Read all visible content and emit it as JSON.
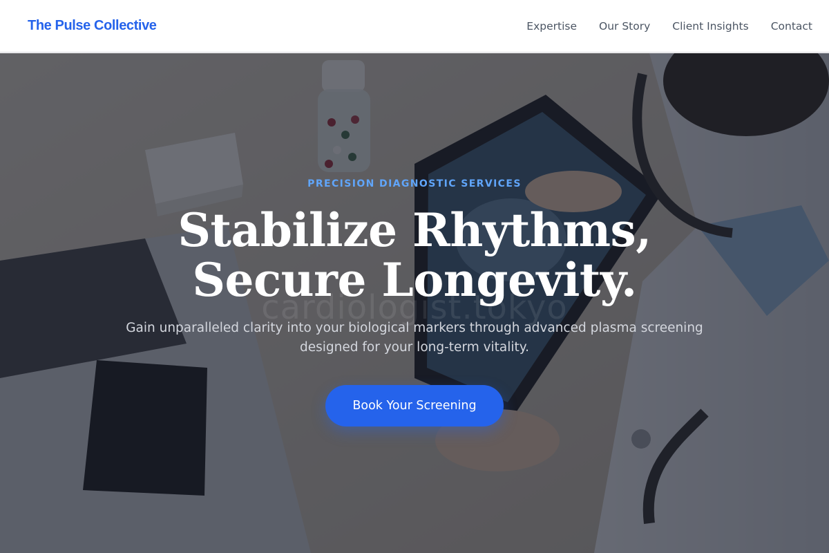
{
  "brand": {
    "name": "The Pulse Collective"
  },
  "nav": {
    "links": [
      "Expertise",
      "Our Story",
      "Client Insights",
      "Contact"
    ]
  },
  "hero": {
    "eyebrow": "PRECISION DIAGNOSTIC SERVICES",
    "headline_line1": "Stabilize Rhythms,",
    "headline_line2": "Secure Longevity.",
    "watermark": "cardiologist.tokyo",
    "subtext": "Gain unparalleled clarity into your biological markers through advanced plasma screening designed for your long-term vitality.",
    "cta_label": "Book Your Screening"
  },
  "colors": {
    "accent": "#2563eb",
    "eyebrow": "#60a5fa",
    "nav_text": "#4b5563",
    "overlay": "rgba(24, 28, 40, 0.62)"
  }
}
